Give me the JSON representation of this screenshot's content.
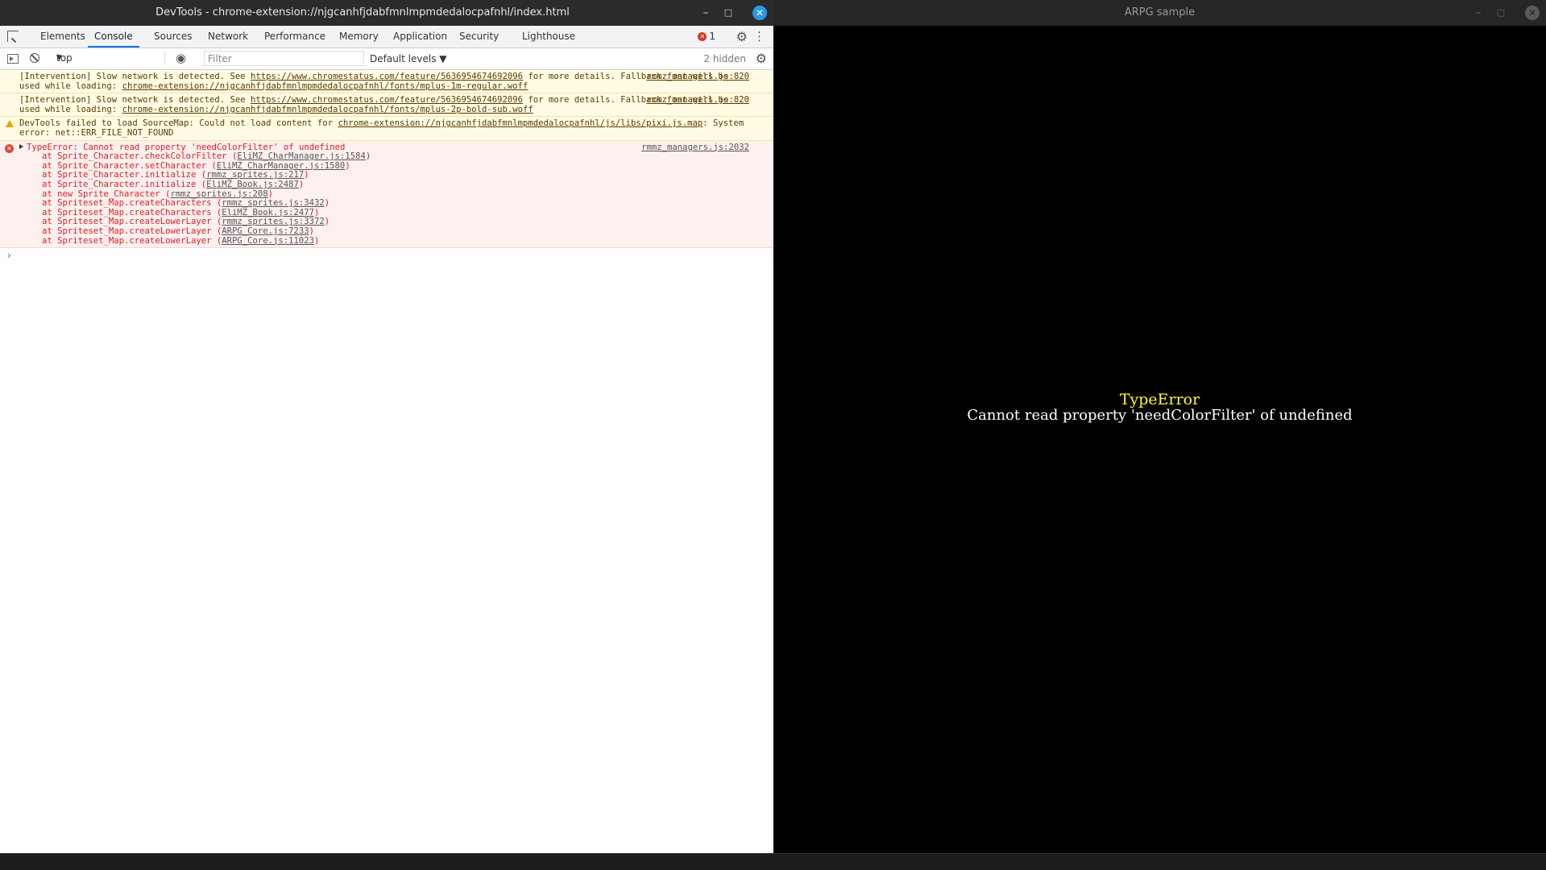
{
  "devtools": {
    "window_title": "DevTools - chrome-extension://njgcanhfjdabfmnlmpmdedalocpafnhl/index.html",
    "window_controls": {
      "minimize": "–",
      "maximize": "□",
      "close": "✕"
    },
    "tabs": [
      "Elements",
      "Console",
      "Sources",
      "Network",
      "Performance",
      "Memory",
      "Application",
      "Security",
      "Lighthouse"
    ],
    "active_tab": "Console",
    "error_count": "1",
    "toolbar": {
      "context": "top",
      "filter_placeholder": "Filter",
      "levels": "Default levels ▼",
      "hidden": "2 hidden"
    },
    "messages": {
      "warn1": {
        "pre": "[Intervention] Slow network is detected. See ",
        "link": "https://www.chromestatus.com/feature/5636954674692096",
        "mid": " for more details. Fallback font will be used while loading: ",
        "link2": "chrome-extension://njgcanhfjdabfmnlmpmdedalocpafnhl/fonts/mplus-1m-regular.woff",
        "source": "rmmz_managers.js:820"
      },
      "warn2": {
        "pre": "[Intervention] Slow network is detected. See ",
        "link": "https://www.chromestatus.com/feature/5636954674692096",
        "mid": " for more details. Fallback font will be used while loading: ",
        "link2": "chrome-extension://njgcanhfjdabfmnlmpmdedalocpafnhl/fonts/mplus-2p-bold-sub.woff",
        "source": "rmmz_managers.js:820"
      },
      "warn3": {
        "pre": "DevTools failed to load SourceMap: Could not load content for ",
        "link": "chrome-extension://njgcanhfjdabfmnlmpmdedalocpafnhl/js/libs/pixi.js.map",
        "post": ": System error: net::ERR_FILE_NOT_FOUND"
      },
      "error": {
        "headline": "TypeError: Cannot read property 'needColorFilter' of undefined",
        "source": "rmmz_managers.js:2032",
        "stack": [
          {
            "fn": "at Sprite_Character.checkColorFilter (",
            "file": "EliMZ_CharManager.js:1584"
          },
          {
            "fn": "at Sprite_Character.setCharacter (",
            "file": "EliMZ_CharManager.js:1580"
          },
          {
            "fn": "at Sprite_Character.initialize (",
            "file": "rmmz_sprites.js:217"
          },
          {
            "fn": "at Sprite_Character.initialize (",
            "file": "EliMZ_Book.js:2487"
          },
          {
            "fn": "at new Sprite_Character (",
            "file": "rmmz_sprites.js:208"
          },
          {
            "fn": "at Spriteset_Map.createCharacters (",
            "file": "rmmz_sprites.js:3432"
          },
          {
            "fn": "at Spriteset_Map.createCharacters (",
            "file": "EliMZ_Book.js:2477"
          },
          {
            "fn": "at Spriteset_Map.createLowerLayer (",
            "file": "rmmz_sprites.js:3372"
          },
          {
            "fn": "at Spriteset_Map.createLowerLayer (",
            "file": "ARPG_Core.js:7233"
          },
          {
            "fn": "at Spriteset_Map.createLowerLayer (",
            "file": "ARPG_Core.js:11023"
          }
        ]
      }
    }
  },
  "game": {
    "window_title": "ARPG sample",
    "error_title": "TypeError",
    "error_message": "Cannot read property 'needColorFilter' of undefined"
  }
}
